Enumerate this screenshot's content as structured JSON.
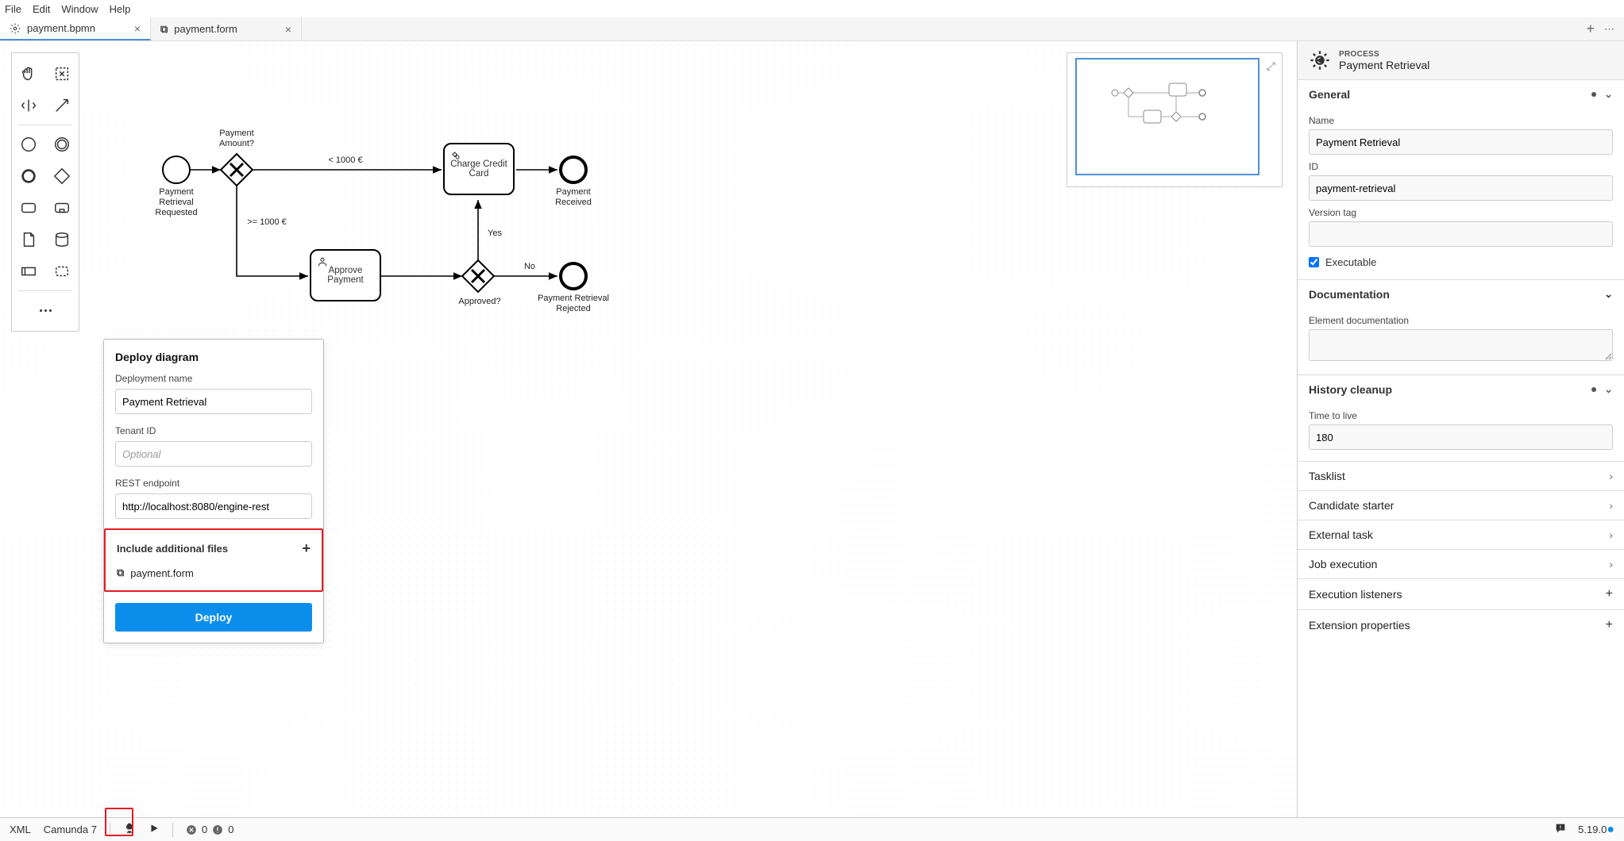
{
  "menubar": [
    "File",
    "Edit",
    "Window",
    "Help"
  ],
  "tabs": [
    {
      "label": "payment.bpmn",
      "active": true,
      "icon": "gear"
    },
    {
      "label": "payment.form",
      "active": false,
      "icon": "form"
    }
  ],
  "palette_tools": [
    "hand",
    "lasso",
    "space",
    "connect",
    "start-event",
    "intermediate-event",
    "end-event",
    "gateway",
    "task",
    "subprocess",
    "data-object",
    "data-store",
    "participant",
    "group",
    "more"
  ],
  "diagram": {
    "start_label": "Payment\nRetrieval\nRequested",
    "gateway1_label": "Payment\nAmount?",
    "branch_lt": "< 1000 €",
    "branch_gte": ">= 1000 €",
    "task_charge": "Charge Credit Card",
    "task_approve": "Approve Payment",
    "gateway2_label": "Approved?",
    "branch_yes": "Yes",
    "branch_no": "No",
    "end_received_label": "Payment\nReceived",
    "end_rejected_label": "Payment Retrieval\nRejected"
  },
  "deploy": {
    "title": "Deploy diagram",
    "deployment_name_label": "Deployment name",
    "deployment_name_value": "Payment Retrieval",
    "tenant_label": "Tenant ID",
    "tenant_placeholder": "Optional",
    "endpoint_label": "REST endpoint",
    "endpoint_value": "http://localhost:8080/engine-rest",
    "include_title": "Include additional files",
    "include_file": "payment.form",
    "button": "Deploy"
  },
  "panel": {
    "kicker": "PROCESS",
    "title": "Payment Retrieval",
    "general": {
      "title": "General",
      "name_label": "Name",
      "name_value": "Payment Retrieval",
      "id_label": "ID",
      "id_value": "payment-retrieval",
      "version_label": "Version tag",
      "version_value": "",
      "executable_label": "Executable",
      "executable_checked": true
    },
    "documentation": {
      "title": "Documentation",
      "doc_label": "Element documentation",
      "doc_value": ""
    },
    "history": {
      "title": "History cleanup",
      "ttl_label": "Time to live",
      "ttl_value": "180"
    },
    "collapsed": [
      {
        "label": "Tasklist",
        "action": "chevron"
      },
      {
        "label": "Candidate starter",
        "action": "chevron"
      },
      {
        "label": "External task",
        "action": "chevron"
      },
      {
        "label": "Job execution",
        "action": "chevron"
      },
      {
        "label": "Execution listeners",
        "action": "plus"
      },
      {
        "label": "Extension properties",
        "action": "plus"
      }
    ]
  },
  "statusbar": {
    "xml": "XML",
    "engine": "Camunda 7",
    "error_count": "0",
    "warn_count": "0",
    "version": "5.19.0"
  }
}
